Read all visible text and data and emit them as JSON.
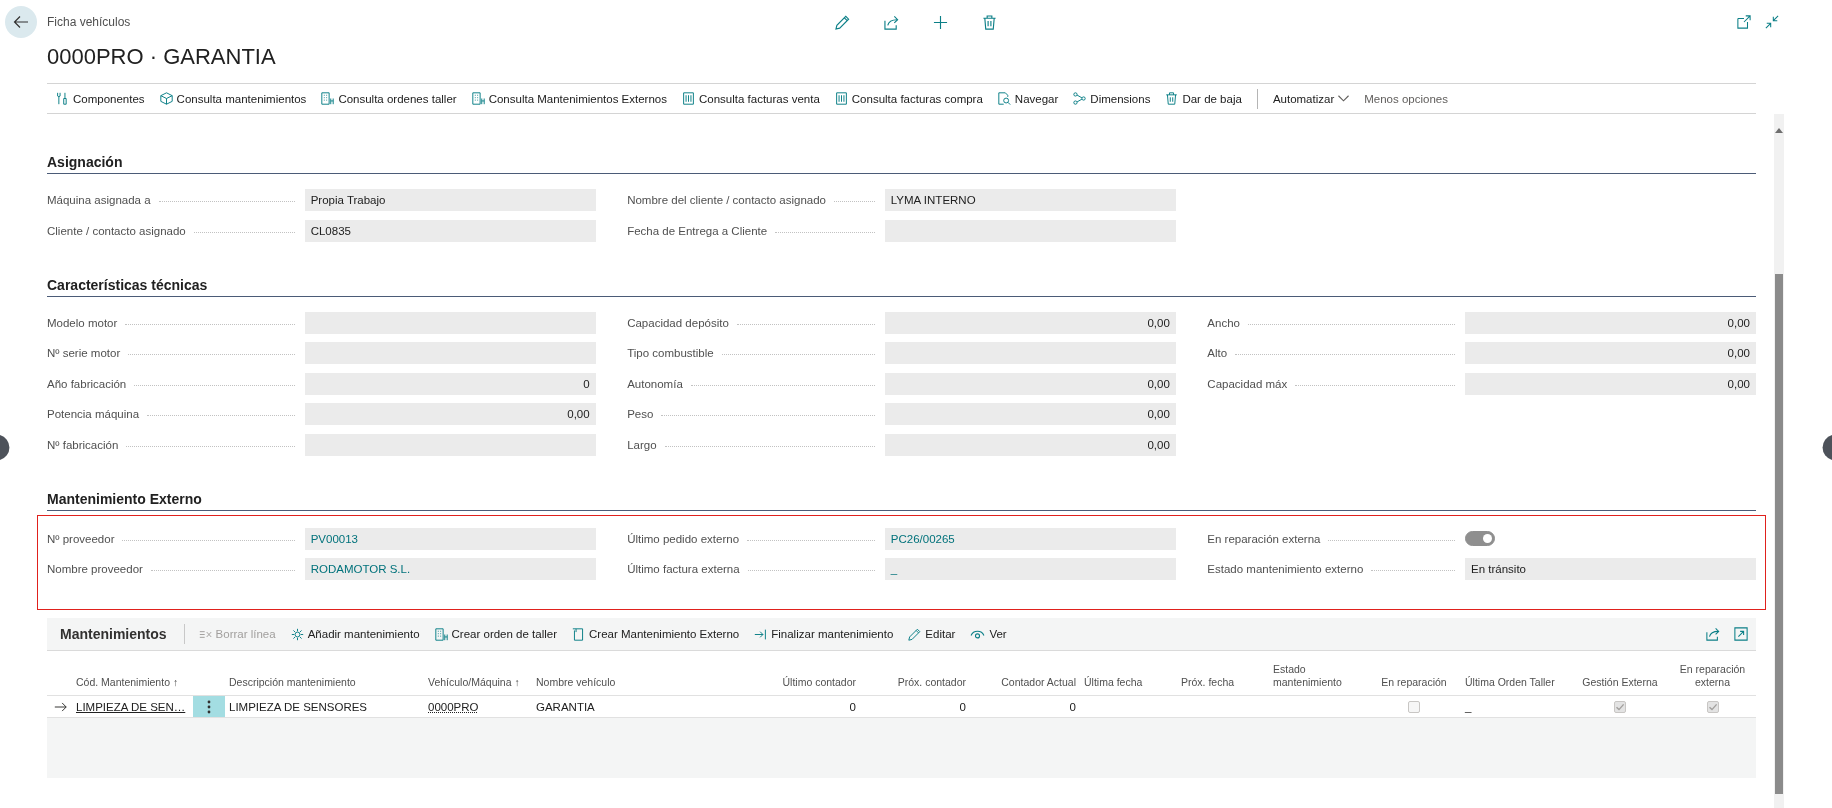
{
  "header": {
    "breadcrumb": "Ficha vehículos",
    "title": "0000PRO · GARANTIA"
  },
  "action_bar": [
    {
      "label": "Componentes",
      "kind": "action"
    },
    {
      "label": "Consulta mantenimientos",
      "kind": "action"
    },
    {
      "label": "Consulta ordenes taller",
      "kind": "action"
    },
    {
      "label": "Consulta Mantenimientos Externos",
      "kind": "action"
    },
    {
      "label": "Consulta facturas venta",
      "kind": "action"
    },
    {
      "label": "Consulta facturas compra",
      "kind": "action"
    },
    {
      "label": "Navegar",
      "kind": "action"
    },
    {
      "label": "Dimensions",
      "kind": "action"
    },
    {
      "label": "Dar de baja",
      "kind": "action"
    },
    {
      "label": "Automatizar",
      "kind": "menu"
    },
    {
      "label": "Menos opciones",
      "kind": "more"
    }
  ],
  "sections": [
    {
      "title": "Asignación",
      "columns": [
        [
          {
            "label": "Máquina asignada a",
            "value": "Propia Trabajo",
            "kind": "text"
          },
          {
            "label": "Cliente / contacto asignado",
            "value": "CL0835",
            "kind": "text"
          }
        ],
        [
          {
            "label": "Nombre del cliente / contacto asignado",
            "value": "LYMA INTERNO",
            "kind": "text"
          },
          {
            "label": "Fecha de Entrega a Cliente",
            "kind": "text"
          }
        ]
      ]
    },
    {
      "title": "Características técnicas",
      "columns": [
        [
          {
            "label": "Modelo motor",
            "kind": "text"
          },
          {
            "label": "Nº serie motor",
            "kind": "text"
          },
          {
            "label": "Año fabricación",
            "value": "0",
            "kind": "number"
          },
          {
            "label": "Potencia máquina",
            "value": "0,00",
            "kind": "number"
          },
          {
            "label": "Nº fabricación",
            "kind": "text"
          }
        ],
        [
          {
            "label": "Capacidad depósito",
            "value": "0,00",
            "kind": "number"
          },
          {
            "label": "Tipo combustible",
            "kind": "text"
          },
          {
            "label": "Autonomía",
            "value": "0,00",
            "kind": "number"
          },
          {
            "label": "Peso",
            "value": "0,00",
            "kind": "number"
          },
          {
            "label": "Largo",
            "value": "0,00",
            "kind": "number"
          }
        ],
        [
          {
            "label": "Ancho",
            "value": "0,00",
            "kind": "number"
          },
          {
            "label": "Alto",
            "value": "0,00",
            "kind": "number"
          },
          {
            "label": "Capacidad máx",
            "value": "0,00",
            "kind": "number"
          }
        ]
      ]
    },
    {
      "title": "Mantenimiento Externo",
      "highlighted": true,
      "columns": [
        [
          {
            "label": "Nº proveedor",
            "value": "PV00013",
            "kind": "link"
          },
          {
            "label": "Nombre proveedor",
            "value": "RODAMOTOR S.L.",
            "kind": "link"
          }
        ],
        [
          {
            "label": "Último pedido externo",
            "value": "PC26/00265",
            "kind": "link"
          },
          {
            "label": "Último factura externa",
            "value": "_",
            "kind": "link"
          }
        ],
        [
          {
            "label": "En reparación externa",
            "kind": "toggle",
            "on": true,
            "disabled": true
          },
          {
            "label": "Estado mantenimiento externo",
            "value": "En tránsito",
            "kind": "text"
          }
        ]
      ]
    }
  ],
  "maintenance_lines": {
    "title": "Mantenimientos",
    "actions": [
      {
        "label": "Borrar línea",
        "disabled": true
      },
      {
        "label": "Añadir mantenimiento",
        "disabled": false
      },
      {
        "label": "Crear orden de taller",
        "disabled": false
      },
      {
        "label": "Crear Mantenimiento Externo",
        "disabled": false
      },
      {
        "label": "Finalizar mantenimiento",
        "disabled": false
      },
      {
        "label": "Editar",
        "disabled": false
      },
      {
        "label": "Ver",
        "disabled": false
      }
    ],
    "columns": [
      {
        "label": "Cód. Mantenimiento ↑",
        "kind": "text"
      },
      {
        "label": "Descripción mantenimiento",
        "kind": "text"
      },
      {
        "label": "Vehículo/Máquina ↑",
        "kind": "text"
      },
      {
        "label": "Nombre vehículo",
        "kind": "text"
      },
      {
        "label": "Último contador",
        "kind": "number"
      },
      {
        "label": "Próx. contador",
        "kind": "number"
      },
      {
        "label": "Contador Actual",
        "kind": "number"
      },
      {
        "label": "Última fecha",
        "kind": "text"
      },
      {
        "label": "Próx. fecha",
        "kind": "text"
      },
      {
        "label": "Estado mantenimiento",
        "kind": "text"
      },
      {
        "label": "En reparación",
        "kind": "flag"
      },
      {
        "label": "Última Orden Taller",
        "kind": "text"
      },
      {
        "label": "Gestión Externa",
        "kind": "flag"
      },
      {
        "label": "En reparación externa",
        "kind": "flag"
      }
    ],
    "rows": [
      {
        "current": true,
        "cells": [
          {
            "kind": "link",
            "value": "LIMPIEZA DE SEN…"
          },
          {
            "kind": "text",
            "value": "LIMPIEZA DE SENSORES"
          },
          {
            "kind": "lookup",
            "value": "0000PRO"
          },
          {
            "kind": "text",
            "value": "GARANTIA"
          },
          {
            "kind": "text",
            "value": "0"
          },
          {
            "kind": "text",
            "value": "0"
          },
          {
            "kind": "text",
            "value": "0"
          },
          {
            "kind": "text"
          },
          {
            "kind": "text"
          },
          {
            "kind": "text"
          },
          {
            "kind": "checkbox",
            "checked": false,
            "disabled": true
          },
          {
            "kind": "text",
            "value": "_"
          },
          {
            "kind": "checkbox",
            "checked": true,
            "disabled": true
          },
          {
            "kind": "checkbox",
            "checked": true,
            "disabled": true
          }
        ]
      }
    ]
  }
}
